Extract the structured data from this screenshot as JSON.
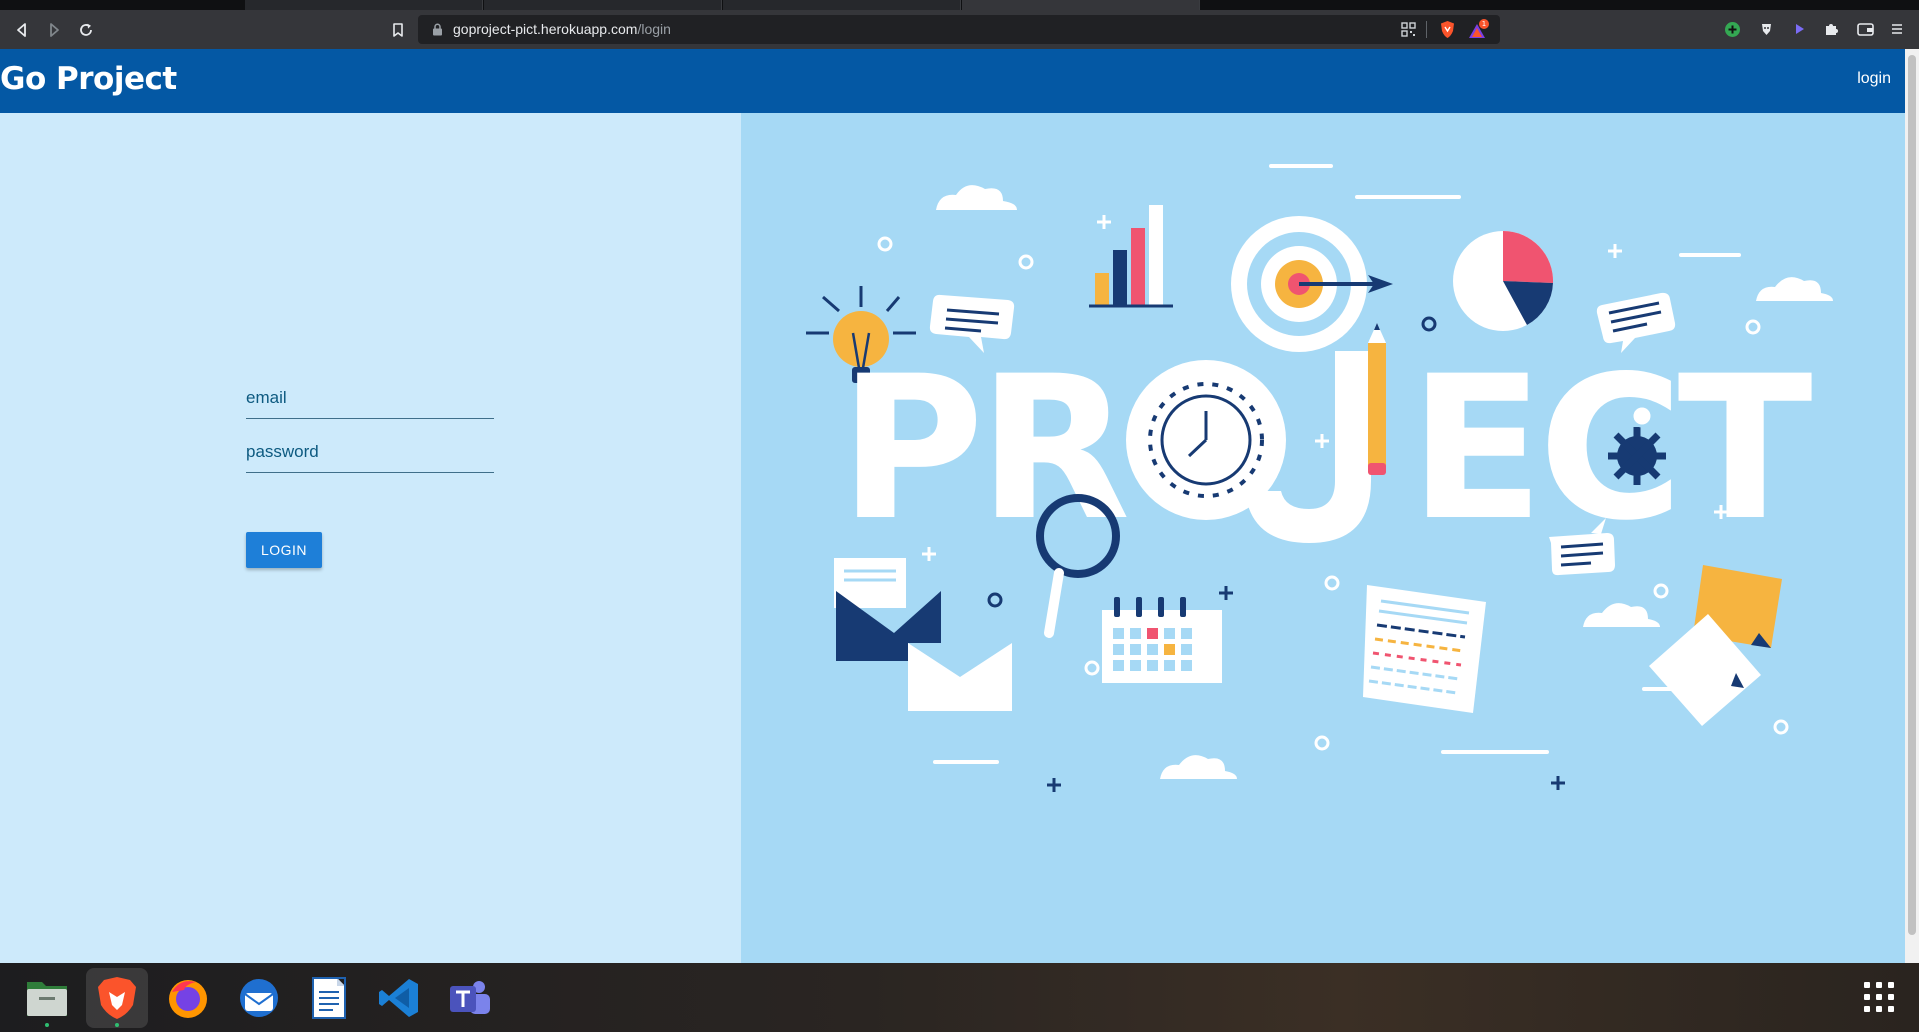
{
  "browser": {
    "url_host": "goproject-pict.herokuapp.com",
    "url_path": "/login",
    "shields_badge": "1"
  },
  "page": {
    "brand": "Go Project",
    "nav_login": "login"
  },
  "login_form": {
    "email_placeholder": "email",
    "password_placeholder": "password",
    "submit_label": "LOGIN"
  },
  "hero": {
    "headline": "PROJECT"
  },
  "colors": {
    "navbar": "#0458a4",
    "left_bg": "#cdeafb",
    "right_bg": "#a6d9f5",
    "button": "#1e7fd8",
    "accent_yellow": "#f6b440",
    "accent_red": "#f05470",
    "accent_navy": "#173a73"
  },
  "dock": {
    "apps": [
      "files-icon",
      "brave-icon",
      "firefox-icon",
      "thunderbird-icon",
      "writer-icon",
      "vscode-icon",
      "teams-icon"
    ]
  }
}
